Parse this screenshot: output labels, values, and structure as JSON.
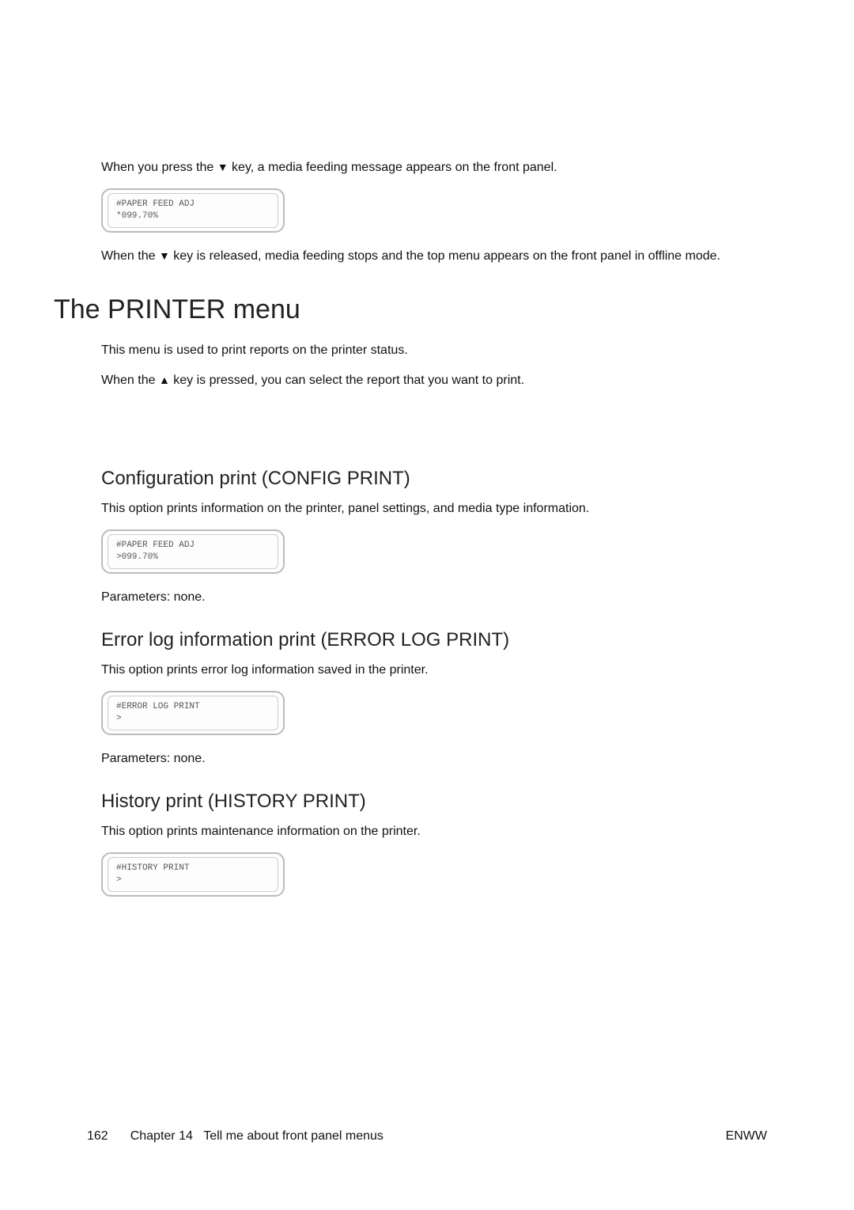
{
  "intro": {
    "p1_a": "When you press the ",
    "p1_key": "▼",
    "p1_b": " key, a media feeding message appears on the front panel.",
    "panel1_line1": "#PAPER FEED ADJ",
    "panel1_line2": "*099.70%",
    "p2_a": "When the ",
    "p2_key": "▼",
    "p2_b": " key is released, media feeding stops and the top menu appears on the front panel in offline mode."
  },
  "section": {
    "title": "The PRINTER menu",
    "p1": "This menu is used to print reports on the printer status.",
    "p2_a": "When the ",
    "p2_key": "▲",
    "p2_b": " key is pressed, you can select the report that you want to print."
  },
  "config": {
    "heading": "Configuration print (CONFIG PRINT)",
    "body": "This option prints information on the printer, panel settings, and media type information.",
    "panel_line1": "#PAPER FEED ADJ",
    "panel_line2": ">099.70%",
    "params": "Parameters: none."
  },
  "errorlog": {
    "heading": "Error log information print (ERROR LOG PRINT)",
    "body": "This option prints error log information saved in the printer.",
    "panel_line1": "#ERROR LOG PRINT",
    "panel_line2": ">",
    "params": "Parameters: none."
  },
  "history": {
    "heading": "History print (HISTORY PRINT)",
    "body": "This option prints maintenance information on the printer.",
    "panel_line1": "#HISTORY PRINT",
    "panel_line2": ">"
  },
  "footer": {
    "page_number": "162",
    "chapter": "Chapter 14",
    "chapter_title": "Tell me about front panel menus",
    "right": "ENWW"
  }
}
